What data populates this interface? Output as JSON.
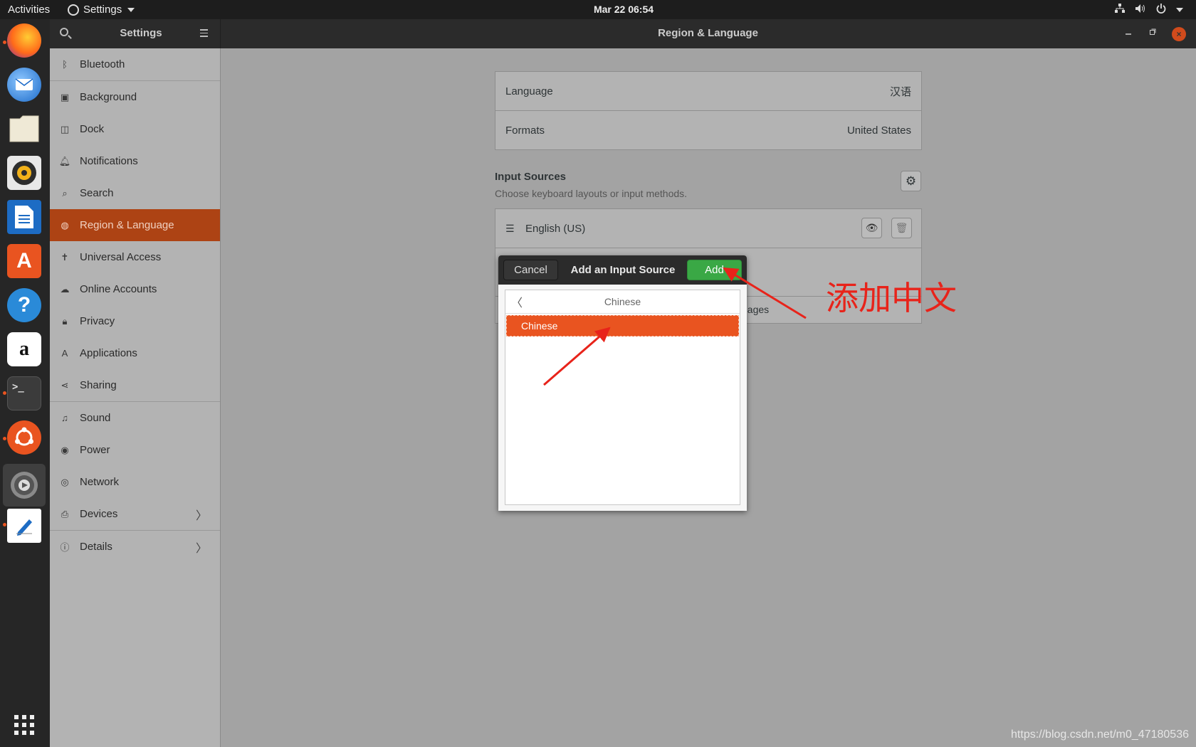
{
  "topbar": {
    "activities": "Activities",
    "app_menu": "Settings",
    "clock": "Mar 22  06:54"
  },
  "dock": {
    "items": [
      "firefox-icon",
      "thunderbird-icon",
      "files-icon",
      "rhythmbox-icon",
      "libreoffice-writer-icon",
      "software-center-icon",
      "help-icon",
      "amazon-icon",
      "terminal-icon",
      "ubuntu-icon",
      "settings-icon",
      "text-editor-icon",
      "show-apps-icon"
    ],
    "amazon_letter": "a",
    "terminal_prompt": ">_"
  },
  "window": {
    "sidebar_title": "Settings",
    "page_title": "Region & Language"
  },
  "sidebar": {
    "items": [
      {
        "label": "Bluetooth",
        "icon": "bluetooth-icon"
      },
      {
        "label": "Background",
        "icon": "background-icon"
      },
      {
        "label": "Dock",
        "icon": "dock-icon"
      },
      {
        "label": "Notifications",
        "icon": "bell-icon"
      },
      {
        "label": "Search",
        "icon": "search-icon"
      },
      {
        "label": "Region & Language",
        "icon": "globe-icon",
        "active": true
      },
      {
        "label": "Universal Access",
        "icon": "accessibility-icon"
      },
      {
        "label": "Online Accounts",
        "icon": "cloud-icon"
      },
      {
        "label": "Privacy",
        "icon": "lock-icon"
      },
      {
        "label": "Applications",
        "icon": "applications-icon"
      },
      {
        "label": "Sharing",
        "icon": "share-icon"
      },
      {
        "label": "Sound",
        "icon": "music-note-icon"
      },
      {
        "label": "Power",
        "icon": "power-icon"
      },
      {
        "label": "Network",
        "icon": "network-icon"
      },
      {
        "label": "Devices",
        "icon": "devices-icon"
      },
      {
        "label": "Details",
        "icon": "info-icon"
      }
    ]
  },
  "region": {
    "language_label": "Language",
    "language_value": "汉语",
    "formats_label": "Formats",
    "formats_value": "United States",
    "input_sources_title": "Input Sources",
    "input_sources_subtitle": "Choose keyboard layouts or input methods.",
    "sources": [
      "English (US)"
    ],
    "partial_button_text": "uages"
  },
  "dialog": {
    "cancel": "Cancel",
    "title": "Add an Input Source",
    "add": "Add",
    "back_title": "Chinese",
    "selected_item": "Chinese"
  },
  "annotation": {
    "text": "添加中文",
    "color": "#e8231a"
  },
  "watermark": "https://blog.csdn.net/m0_47180536",
  "colors": {
    "accent": "#e95420",
    "add_green": "#3aa845",
    "sidebar_active": "#ad4314"
  }
}
